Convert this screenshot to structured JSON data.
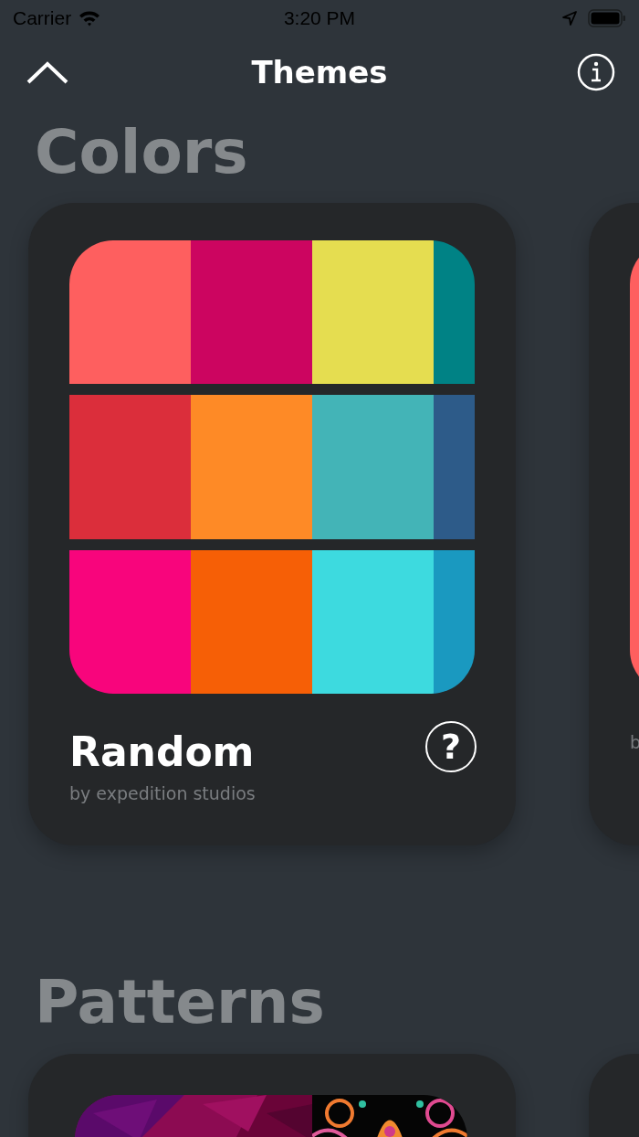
{
  "status_bar": {
    "carrier": "Carrier",
    "time": "3:20 PM"
  },
  "nav": {
    "title": "Themes"
  },
  "colors": {
    "title": "Colors",
    "cards": [
      {
        "title": "Random",
        "subtitle": "by expedition studios",
        "help": "?",
        "palette": [
          [
            {
              "color": "#fe5f5f"
            },
            {
              "color": "#cc0560"
            },
            {
              "color": "#e5dd50"
            },
            {
              "color": "#008285"
            }
          ],
          [
            {
              "color": "#db2e3b"
            },
            {
              "color": "#fe8a26"
            },
            {
              "color": "#43b4b7"
            },
            {
              "color": "#2d5b89"
            }
          ],
          [
            {
              "color": "#f8057c"
            },
            {
              "color": "#f65f06"
            },
            {
              "color": "#3ddadf"
            },
            {
              "color": "#1a99c0"
            }
          ]
        ]
      },
      {
        "subtitle": "b",
        "palette": [
          [
            {
              "color": "#fe5f5f"
            }
          ]
        ]
      }
    ]
  },
  "patterns": {
    "title": "Patterns",
    "cards": [
      {
        "kind": "previews"
      },
      {
        "kind": "empty"
      }
    ]
  }
}
